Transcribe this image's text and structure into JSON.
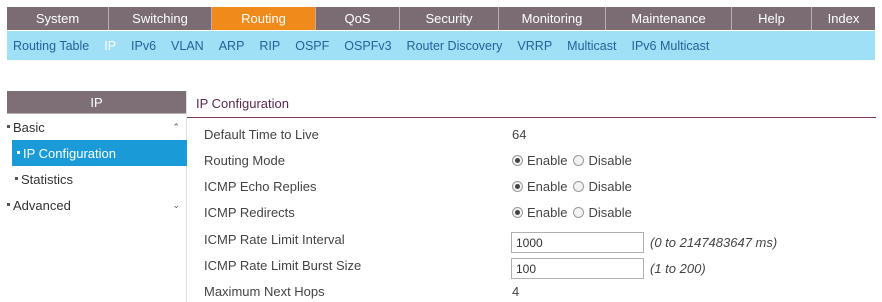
{
  "topnav": {
    "tabs": [
      {
        "label": "System",
        "width": 102
      },
      {
        "label": "Switching",
        "width": 103
      },
      {
        "label": "Routing",
        "width": 104,
        "active": true
      },
      {
        "label": "QoS",
        "width": 84
      },
      {
        "label": "Security",
        "width": 99
      },
      {
        "label": "Monitoring",
        "width": 107
      },
      {
        "label": "Maintenance",
        "width": 126
      },
      {
        "label": "Help",
        "width": 80
      },
      {
        "label": "Index",
        "width": 63
      }
    ]
  },
  "subnav": {
    "items": [
      "Routing Table",
      "IP",
      "IPv6",
      "VLAN",
      "ARP",
      "RIP",
      "OSPF",
      "OSPFv3",
      "Router Discovery",
      "VRRP",
      "Multicast",
      "IPv6 Multicast"
    ],
    "active": "IP"
  },
  "sidebar": {
    "header": "IP",
    "items": [
      {
        "label": "Basic",
        "level": 1,
        "chevron": "^"
      },
      {
        "label": "IP Configuration",
        "level": 2,
        "active": true
      },
      {
        "label": "Statistics",
        "level": 2
      },
      {
        "label": "Advanced",
        "level": 1,
        "chevron": "v"
      }
    ]
  },
  "main": {
    "tab_label": "IP Configuration",
    "fields": {
      "ttl": {
        "label": "Default Time to Live",
        "value": "64"
      },
      "routing_mode": {
        "label": "Routing Mode",
        "opt1": "Enable",
        "opt2": "Disable",
        "selected": "Enable"
      },
      "icmp_echo": {
        "label": "ICMP Echo Replies",
        "opt1": "Enable",
        "opt2": "Disable",
        "selected": "Enable"
      },
      "icmp_redirects": {
        "label": "ICMP Redirects",
        "opt1": "Enable",
        "opt2": "Disable",
        "selected": "Enable"
      },
      "icmp_rate_interval": {
        "label": "ICMP Rate Limit Interval",
        "value": "1000",
        "hint": "(0 to 2147483647 ms)"
      },
      "icmp_rate_burst": {
        "label": "ICMP Rate Limit Burst Size",
        "value": "100",
        "hint": "(1 to 200)"
      },
      "max_next_hops": {
        "label": "Maximum Next Hops",
        "value": "4"
      }
    }
  },
  "colors": {
    "topnav_bg": "#7b6c74",
    "active_orange": "#f08a1b",
    "subnav_bg": "#9fe0f6",
    "sidebar_active": "#1a9ad6",
    "tab_accent": "#7a3a6a"
  }
}
